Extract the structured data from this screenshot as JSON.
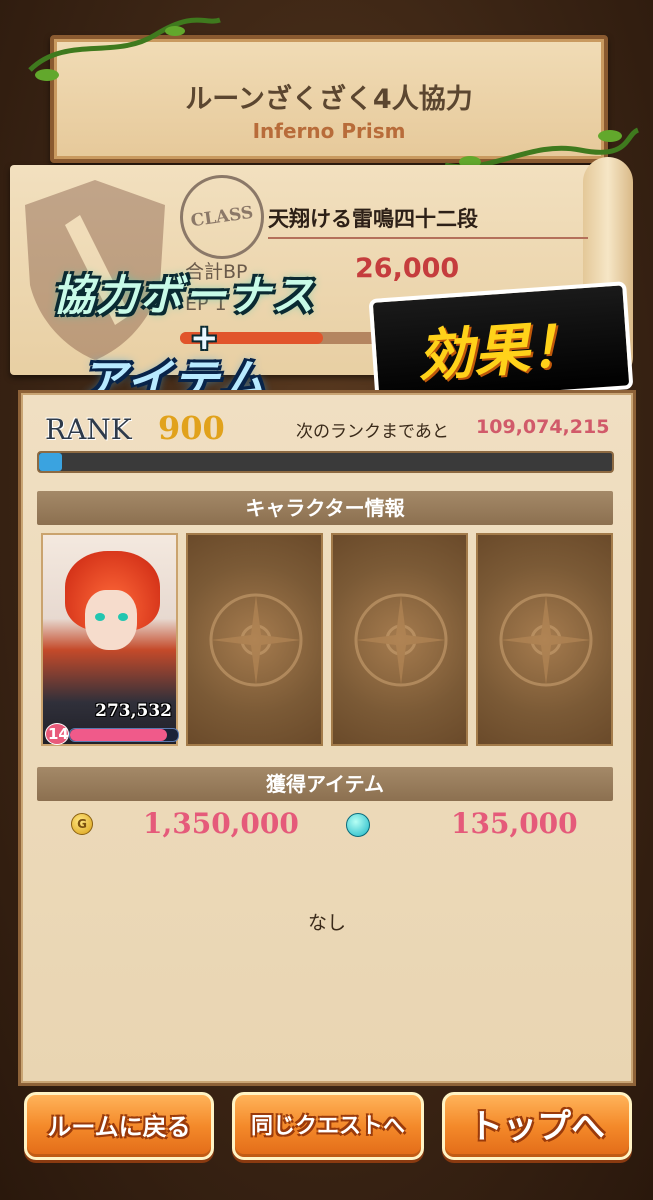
{
  "banner": {
    "title": "ルーンざくざく4人協力",
    "subtitle": "Inferno Prism"
  },
  "class_card": {
    "stamp": "CLASS",
    "name": "天翔ける雷鳴四十二段",
    "bp_label": "合計BP",
    "bp_value": "26,000",
    "ep_label": "EP 1",
    "ep_value": "1"
  },
  "promo": {
    "line1": "協力ボーナス",
    "plus": "+",
    "line2": "アイテム",
    "effect": "効果！"
  },
  "rank": {
    "label": "RANK",
    "value": "900",
    "next_label": "次のランクまであと",
    "next_value": "109,074,215",
    "progress": 0.04
  },
  "character_section": {
    "title": "キャラクター情報"
  },
  "hero": {
    "power": "273,532",
    "level": "14",
    "hp": 0.9
  },
  "items_section": {
    "title": "獲得アイテム",
    "gold_icon": "G",
    "gold_value": "1,350,000",
    "rune_value": "135,000",
    "none_text": "なし"
  },
  "buttons": {
    "back_room": "ルームに戻る",
    "same_quest": "同じクエストへ",
    "top": "トップへ"
  },
  "colors": {
    "accent": "#f48a2a",
    "value_pink": "#e55a7a",
    "rank_gold": "#e1a21c"
  }
}
